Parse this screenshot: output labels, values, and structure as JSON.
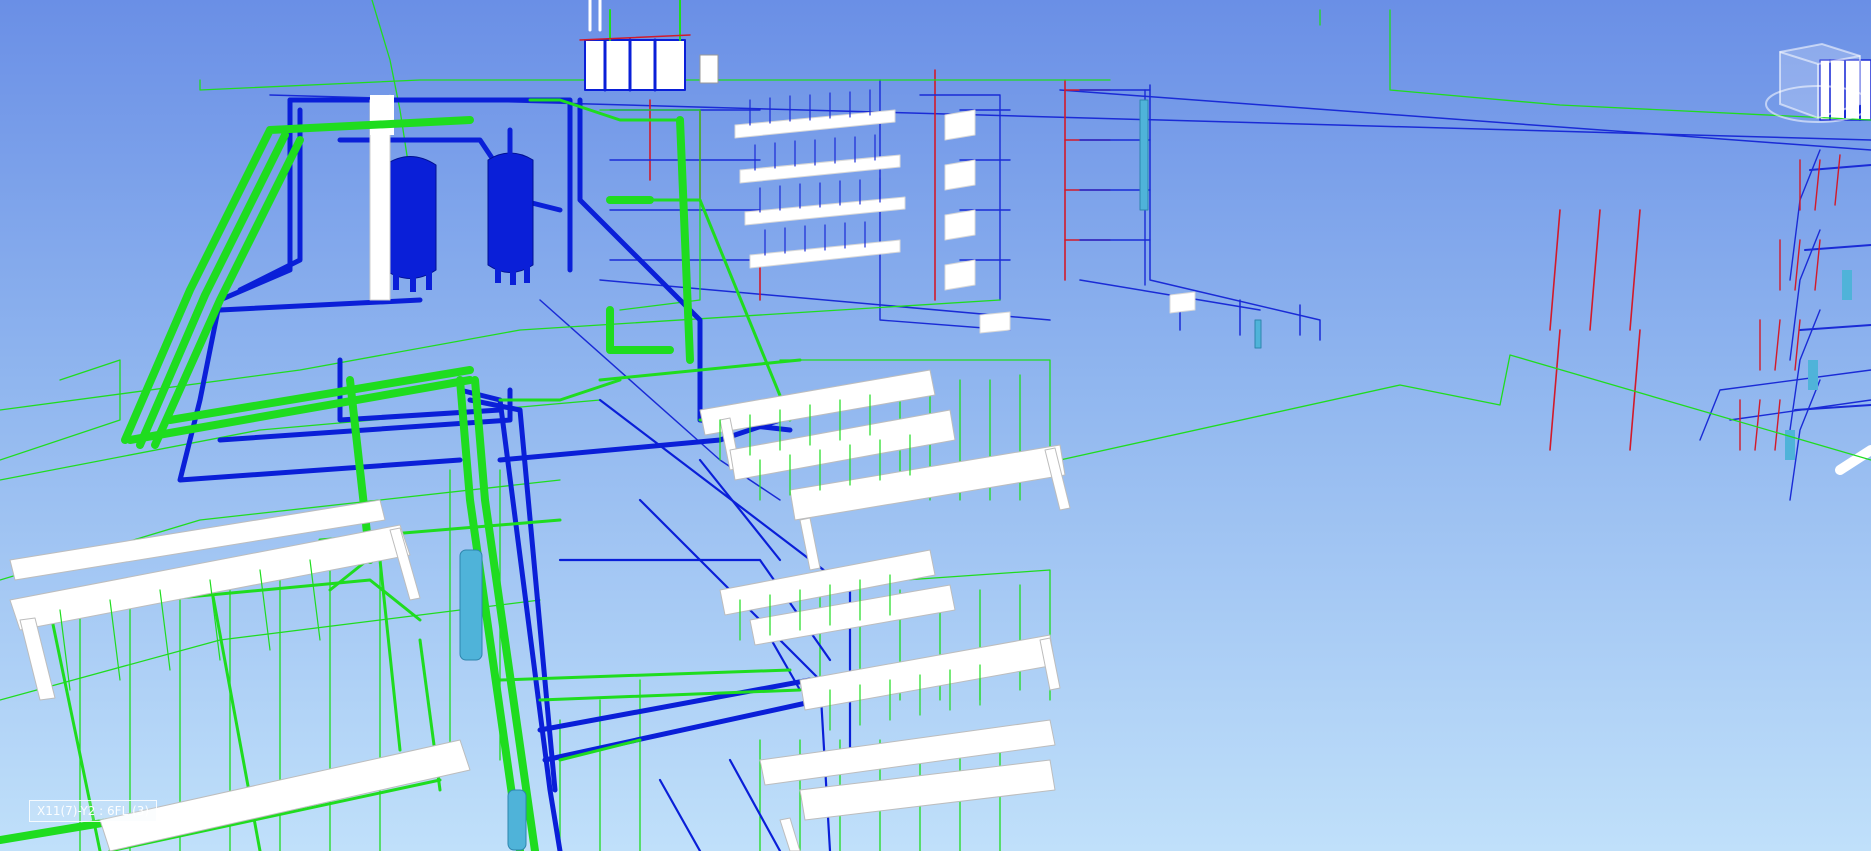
{
  "viewer": {
    "level_indicator": "X11(7)-Y2 : 6FL (3)"
  },
  "colors": {
    "sky_top": "#6a8fe6",
    "sky_bottom": "#c0e0fa",
    "water_supply_pipe": "#1fdc1f",
    "drain_pipe": "#0a1fd8",
    "hot_water_pipe": "#d21a2a",
    "fixture": "#ffffff",
    "equipment_tank": "#0a1fd8",
    "valve": "#4fb3d9"
  },
  "icons": {
    "view_cube": "view-cube-icon"
  }
}
